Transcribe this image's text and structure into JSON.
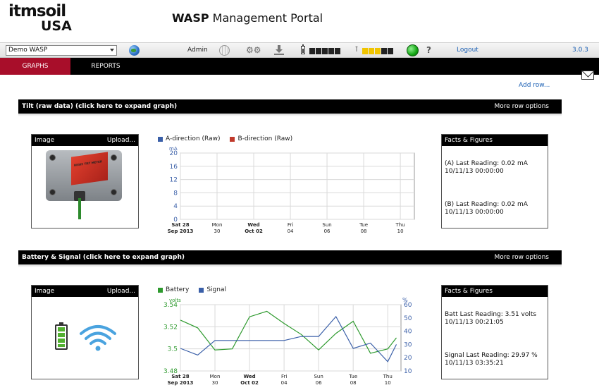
{
  "app": {
    "logo_top": "itmsoil",
    "logo_bottom": "USA",
    "title_bold": "WASP",
    "title_rest": "Management Portal"
  },
  "toolbar": {
    "site_select": "Demo WASP",
    "user": "Admin",
    "logout": "Logout",
    "version": "3.0.3",
    "battery_meter": {
      "segments": 5,
      "lit": 0
    },
    "signal_meter": {
      "segments": 5,
      "lit": 3
    },
    "icons": [
      "globe-icon",
      "network-icon",
      "gear-icon",
      "download-icon",
      "battery-icon",
      "signal-icon",
      "status-icon",
      "help-icon"
    ],
    "status_color": "#15a815",
    "meter_lit_color": "#f0c400"
  },
  "nav": {
    "tabs": [
      {
        "label": "GRAPHS",
        "active": true
      },
      {
        "label": "REPORTS",
        "active": false
      }
    ],
    "accent": "#a80e2a"
  },
  "add_row": "Add row...",
  "panels": [
    {
      "title": "Tilt (raw data) (click here to expand graph)",
      "more": "More row options",
      "image_box": {
        "head": "Image",
        "action": "Upload...",
        "sensor_label": "RESIS TILT METER"
      },
      "facts": {
        "head": "Facts & Figures",
        "lines_a": [
          "(A) Last Reading: 0.02 mA",
          "10/11/13 00:00:00"
        ],
        "lines_b": [
          "(B) Last Reading: 0.02 mA",
          "10/11/13 00:00:00"
        ]
      }
    },
    {
      "title": "Battery & Signal (click here to expand graph)",
      "more": "More row options",
      "image_box": {
        "head": "Image",
        "action": "Upload..."
      },
      "facts": {
        "head": "Facts & Figures",
        "lines_a": [
          "Batt Last Reading: 3.51 volts",
          "10/11/13 00:21:05"
        ],
        "lines_b": [
          "Signal Last Reading: 29.97 %",
          "10/11/13 03:35:21"
        ]
      }
    }
  ],
  "chart_data": [
    {
      "type": "line",
      "title": "",
      "legend_placement": "top",
      "grid": true,
      "ylabel": "mA",
      "ylim": [
        0,
        20
      ],
      "yticks": [
        0,
        4,
        8,
        12,
        16,
        20
      ],
      "xlim": [
        "2013-09-28",
        "2013-10-10"
      ],
      "xticks": [
        {
          "date": "2013-09-28",
          "line1": "Sat 28",
          "line2": "Sep 2013",
          "bold": true
        },
        {
          "date": "2013-09-30",
          "line1": "Mon",
          "line2": "30",
          "bold": false
        },
        {
          "date": "2013-10-02",
          "line1": "Wed",
          "line2": "Oct 02",
          "bold": true
        },
        {
          "date": "2013-10-04",
          "line1": "Fri",
          "line2": "04",
          "bold": false
        },
        {
          "date": "2013-10-06",
          "line1": "Sun",
          "line2": "06",
          "bold": false
        },
        {
          "date": "2013-10-08",
          "line1": "Tue",
          "line2": "08",
          "bold": false
        },
        {
          "date": "2013-10-10",
          "line1": "Thu",
          "line2": "10",
          "bold": false
        }
      ],
      "series": [
        {
          "name": "A-direction (Raw)",
          "color": "#3a5fa8",
          "x": [],
          "y": []
        },
        {
          "name": "B-direction (Raw)",
          "color": "#c0392b",
          "x": [],
          "y": []
        }
      ]
    },
    {
      "type": "line",
      "title": "",
      "legend_placement": "top",
      "grid": true,
      "ylabel": "volts",
      "ylabel_right": "%",
      "ylim": [
        3.48,
        3.54
      ],
      "yticks": [
        3.48,
        3.5,
        3.52,
        3.54
      ],
      "ylim_right": [
        10,
        60
      ],
      "yticks_right": [
        10,
        20,
        30,
        40,
        50,
        60
      ],
      "xlim": [
        "2013-09-28",
        "2013-10-10"
      ],
      "xticks": [
        {
          "date": "2013-09-28",
          "line1": "Sat 28",
          "line2": "Sep 2013",
          "bold": true
        },
        {
          "date": "2013-09-30",
          "line1": "Mon",
          "line2": "30",
          "bold": false
        },
        {
          "date": "2013-10-02",
          "line1": "Wed",
          "line2": "Oct 02",
          "bold": true
        },
        {
          "date": "2013-10-04",
          "line1": "Fri",
          "line2": "04",
          "bold": false
        },
        {
          "date": "2013-10-06",
          "line1": "Sun",
          "line2": "06",
          "bold": false
        },
        {
          "date": "2013-10-08",
          "line1": "Tue",
          "line2": "08",
          "bold": false
        },
        {
          "date": "2013-10-10",
          "line1": "Thu",
          "line2": "10",
          "bold": false
        }
      ],
      "series": [
        {
          "name": "Battery",
          "color": "#2e9a2e",
          "axis": "left",
          "x": [
            "2013-09-28",
            "2013-09-29",
            "2013-09-30",
            "2013-10-01",
            "2013-10-02",
            "2013-10-03",
            "2013-10-04",
            "2013-10-05",
            "2013-10-06",
            "2013-10-07",
            "2013-10-08",
            "2013-10-09",
            "2013-10-10",
            "2013-10-10T12:00"
          ],
          "y": [
            3.526,
            3.519,
            3.499,
            3.5,
            3.529,
            3.534,
            3.523,
            3.513,
            3.499,
            3.514,
            3.525,
            3.496,
            3.5,
            3.51
          ]
        },
        {
          "name": "Signal",
          "color": "#3a5fa8",
          "axis": "right",
          "x": [
            "2013-09-28",
            "2013-09-29",
            "2013-09-30",
            "2013-10-01",
            "2013-10-02",
            "2013-10-03",
            "2013-10-04",
            "2013-10-05",
            "2013-10-06",
            "2013-10-07",
            "2013-10-08",
            "2013-10-09",
            "2013-10-10",
            "2013-10-10T12:00"
          ],
          "y": [
            27,
            22,
            33,
            33,
            33,
            33,
            33,
            36,
            36,
            51,
            27,
            31,
            17,
            30
          ]
        }
      ]
    }
  ]
}
